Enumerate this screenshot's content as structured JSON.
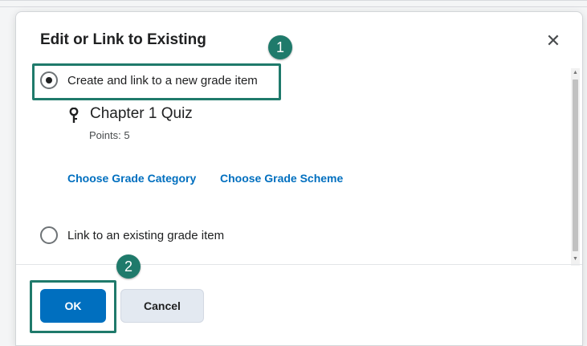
{
  "dialog": {
    "title": "Edit or Link to Existing",
    "close_icon": "close-icon"
  },
  "options": {
    "create_label": "Create and link to a new grade item",
    "create_checked": true,
    "link_label": "Link to an existing grade item",
    "link_checked": false
  },
  "grade_item": {
    "name": "Chapter 1 Quiz",
    "points": "Points: 5",
    "icon": "pin-icon"
  },
  "links": {
    "category": "Choose Grade Category",
    "scheme": "Choose Grade Scheme"
  },
  "footer": {
    "ok_label": "OK",
    "cancel_label": "Cancel"
  },
  "callouts": {
    "step1": "1",
    "step2": "2",
    "color": "#1f7a6b"
  },
  "colors": {
    "accent": "#006fbf",
    "text": "#202122"
  }
}
